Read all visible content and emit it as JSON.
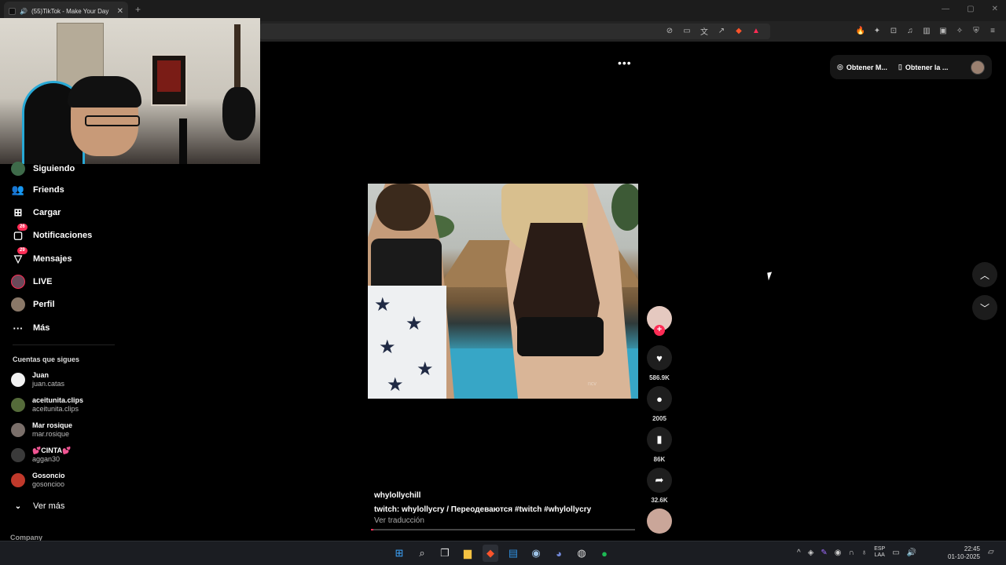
{
  "browser": {
    "tab_title": "(55)TikTok - Make Your Day",
    "new_tab": "+",
    "tab_close": "✕",
    "window_controls": [
      "—",
      "▢",
      "✕"
    ]
  },
  "sidebar": {
    "items": [
      {
        "label": "Siguiendo",
        "icon": "following-icon"
      },
      {
        "label": "Friends",
        "icon": "friends-icon"
      },
      {
        "label": "Cargar",
        "icon": "upload-icon"
      },
      {
        "label": "Notificaciones",
        "icon": "notifications-icon",
        "badge": "26"
      },
      {
        "label": "Mensajes",
        "icon": "messages-icon",
        "badge": "29"
      },
      {
        "label": "LIVE",
        "icon": "live-icon"
      },
      {
        "label": "Perfil",
        "icon": "profile-avatar"
      },
      {
        "label": "Más",
        "icon": "more-icon"
      }
    ],
    "following_title": "Cuentas que sigues",
    "following": [
      {
        "name": "Juan",
        "handle": "juan.catas",
        "color": "#f2f2f2"
      },
      {
        "name": "aceitunita.clips",
        "handle": "aceitunita.clips",
        "color": "#556b3a"
      },
      {
        "name": "Mar rosique",
        "handle": "mar.rosique",
        "color": "#7a6f6a"
      },
      {
        "name": "💕CINTA💕",
        "handle": "aggan30",
        "color": "#3a3a3a"
      },
      {
        "name": "Gosoncio",
        "handle": "gosoncioo",
        "color": "#c0392b"
      }
    ],
    "see_more": "Ver más",
    "company": "Company"
  },
  "header": {
    "more_dots": "•••",
    "pill_1": "Obtener M...",
    "pill_2": "Obtener la ..."
  },
  "video": {
    "watermark": "ncv"
  },
  "actions": {
    "likes": "586.9K",
    "comments": "2005",
    "saves": "86K",
    "shares": "32.6K",
    "progress": 0.01
  },
  "caption": {
    "username": "whylollychill",
    "description": "twitch: whylollycry / Переодеваются #twitch  #whylollycry",
    "translate": "Ver traducción"
  },
  "taskbar": {
    "lang_1": "ESP",
    "lang_2": "LAA",
    "time": "22:45",
    "date": "01-10-2025"
  },
  "colors": {
    "accent": "#fe2c55",
    "background": "#000000"
  }
}
